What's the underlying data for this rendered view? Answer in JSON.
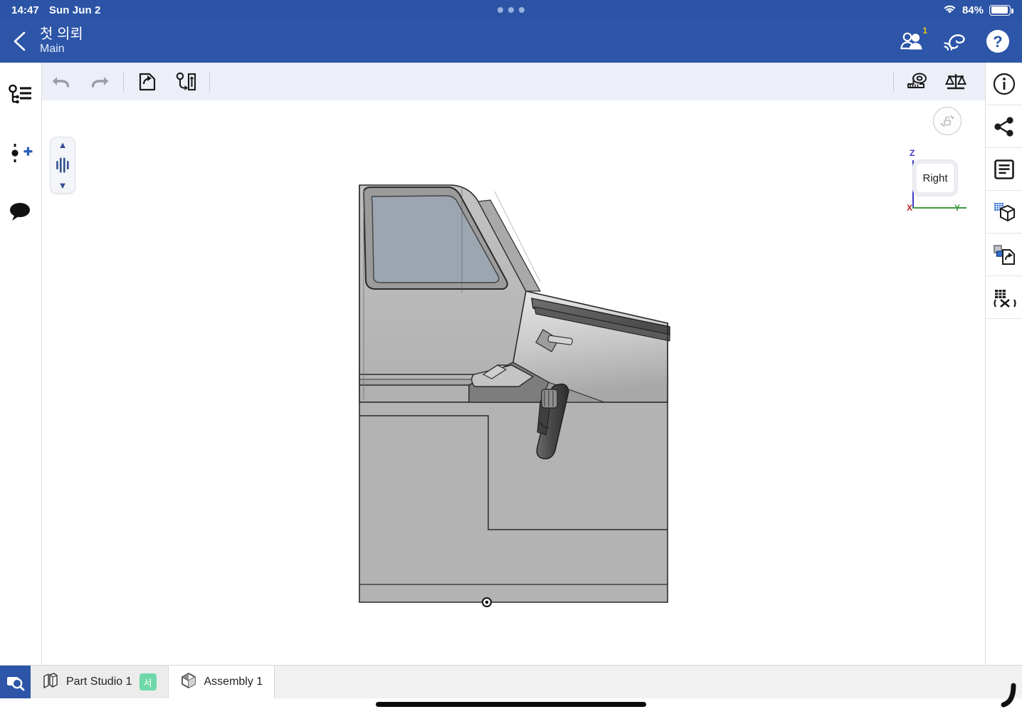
{
  "status_bar": {
    "time": "14:47",
    "date": "Sun Jun 2",
    "battery_percent": "84%",
    "wifi_icon": "wifi-icon",
    "battery_icon": "battery-icon",
    "multitask_dots": "multitasking-dots"
  },
  "header": {
    "back_icon": "back-chevron-icon",
    "document_title": "첫 의뢰",
    "workspace": "Main",
    "collaborators_icon": "people-icon",
    "collaborators_badge": "1",
    "follow_icon": "follow-mode-icon",
    "help_icon": "help-icon",
    "background_color": "#2d55a8"
  },
  "left_rail": {
    "items": [
      {
        "name": "feature-list-icon",
        "label": "Feature list"
      },
      {
        "name": "add-mate-icon",
        "label": "Add mate"
      },
      {
        "name": "comments-icon",
        "label": "Comments"
      }
    ]
  },
  "toolbar": {
    "undo": {
      "name": "undo-icon",
      "label": "Undo",
      "disabled": true
    },
    "redo": {
      "name": "redo-icon",
      "label": "Redo",
      "disabled": true
    },
    "insert": {
      "name": "insert-part-icon",
      "label": "Insert"
    },
    "transform": {
      "name": "transform-icon",
      "label": "Transform"
    },
    "measure": {
      "name": "measure-tape-icon",
      "label": "Measure"
    },
    "mass_properties": {
      "name": "mass-properties-icon",
      "label": "Mass properties"
    },
    "background_color": "#eceef8"
  },
  "right_rail": {
    "items": [
      {
        "name": "info-icon",
        "label": "Details"
      },
      {
        "name": "share-icon",
        "label": "Share"
      },
      {
        "name": "bill-of-materials-icon",
        "label": "Bill of materials"
      },
      {
        "name": "appearance-cube-icon",
        "label": "Display state"
      },
      {
        "name": "export-copy-icon",
        "label": "Export"
      },
      {
        "name": "variables-table-icon",
        "label": "Variables"
      }
    ]
  },
  "canvas": {
    "panel_slider": {
      "name": "panel-slider",
      "up_chevron": "▲",
      "down_chevron": "▼",
      "handle_icon": "slider-handle-icon"
    },
    "rotation_lock": {
      "name": "rotation-lock-icon",
      "label": "Rotation lock"
    },
    "view_cube": {
      "face_label": "Right",
      "axis_z": "Z",
      "axis_y": "Y",
      "axis_x": "X",
      "axis_z_color": "#3b3bbf",
      "axis_y_color": "#3f9b3f",
      "axis_x_color": "#b62a2a"
    },
    "model": {
      "name": "vehicle-cab-assembly",
      "origin_marker": "origin-point",
      "body_color": "#b2b2b2",
      "window_color": "#9ba8b2",
      "trim_color": "#4a4a4a"
    }
  },
  "tab_bar": {
    "search_icon": "search-tab-icon",
    "tabs": [
      {
        "name": "tab-part-studio-1",
        "label": "Part Studio 1",
        "icon": "part-studio-icon",
        "ime_badge": "서",
        "active": false
      },
      {
        "name": "tab-assembly-1",
        "label": "Assembly 1",
        "icon": "assembly-cube-icon",
        "active": true
      }
    ]
  }
}
